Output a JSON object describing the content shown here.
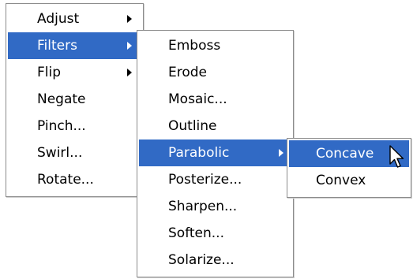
{
  "colors": {
    "menu_background": "#ffffff",
    "selection": "#316ac5",
    "border": "#8c8c8c"
  },
  "main_menu": {
    "items": [
      {
        "label": "Adjust",
        "submenu": true
      },
      {
        "label": "Filters",
        "submenu": true,
        "selected": true
      },
      {
        "label": "Flip",
        "submenu": true
      },
      {
        "label": "Negate"
      },
      {
        "label": "Pinch..."
      },
      {
        "label": "Swirl..."
      },
      {
        "label": "Rotate..."
      }
    ]
  },
  "filters_menu": {
    "items": [
      {
        "label": "Emboss"
      },
      {
        "label": "Erode"
      },
      {
        "label": "Mosaic..."
      },
      {
        "label": "Outline"
      },
      {
        "label": "Parabolic",
        "submenu": true,
        "selected": true
      },
      {
        "label": "Posterize..."
      },
      {
        "label": "Sharpen..."
      },
      {
        "label": "Soften..."
      },
      {
        "label": "Solarize..."
      }
    ]
  },
  "parabolic_menu": {
    "items": [
      {
        "label": "Concave",
        "selected": true
      },
      {
        "label": "Convex"
      }
    ]
  },
  "cursor": {
    "icon": "mouse-pointer-icon"
  }
}
